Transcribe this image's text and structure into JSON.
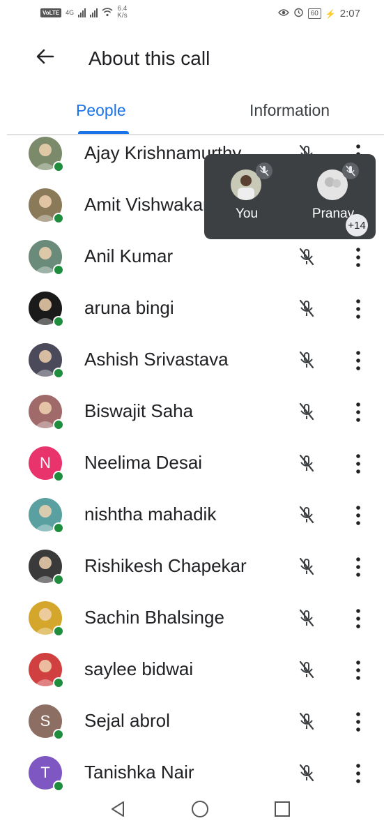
{
  "status_bar": {
    "volte": "VoLTE",
    "network": "4G",
    "speed_value": "6.4",
    "speed_unit": "K/s",
    "battery": "60",
    "time": "2:07"
  },
  "header": {
    "title": "About this call"
  },
  "tabs": [
    {
      "label": "People",
      "active": true
    },
    {
      "label": "Information",
      "active": false
    }
  ],
  "participants": [
    {
      "name": "Ajay Krishnamurthy",
      "avatar_color": "#7a8a6a"
    },
    {
      "name": "Amit Vishwakarma",
      "avatar_color": "#8a7a5a"
    },
    {
      "name": "Anil Kumar",
      "avatar_color": "#6a8a7a"
    },
    {
      "name": "aruna bingi",
      "avatar_color": "#1a1a1a"
    },
    {
      "name": "Ashish Srivastava",
      "avatar_color": "#4a4a5a"
    },
    {
      "name": "Biswajit Saha",
      "avatar_color": "#a06a6a"
    },
    {
      "name": "Neelima Desai",
      "avatar_letter": "N",
      "avatar_color": "#e8336d"
    },
    {
      "name": "nishtha mahadik",
      "avatar_color": "#5aa0a0"
    },
    {
      "name": "Rishikesh Chapekar",
      "avatar_color": "#3a3a3a"
    },
    {
      "name": "Sachin Bhalsinge",
      "avatar_color": "#d4a72c"
    },
    {
      "name": "saylee bidwai",
      "avatar_color": "#d04040"
    },
    {
      "name": "Sejal abrol",
      "avatar_letter": "S",
      "avatar_color": "#8d6e63"
    },
    {
      "name": "Tanishka Nair",
      "avatar_letter": "T",
      "avatar_color": "#7e57c2"
    }
  ],
  "floating_view": {
    "tiles": [
      {
        "label": "You"
      },
      {
        "label": "Pranav"
      }
    ],
    "extra_count": "+14"
  },
  "colors": {
    "accent": "#1a73e8",
    "online": "#1e8e3e",
    "overlay": "#3c4043"
  },
  "icons": {
    "back": "arrow-left-icon",
    "mic_off": "mic-off-icon",
    "more": "more-vert-icon"
  }
}
